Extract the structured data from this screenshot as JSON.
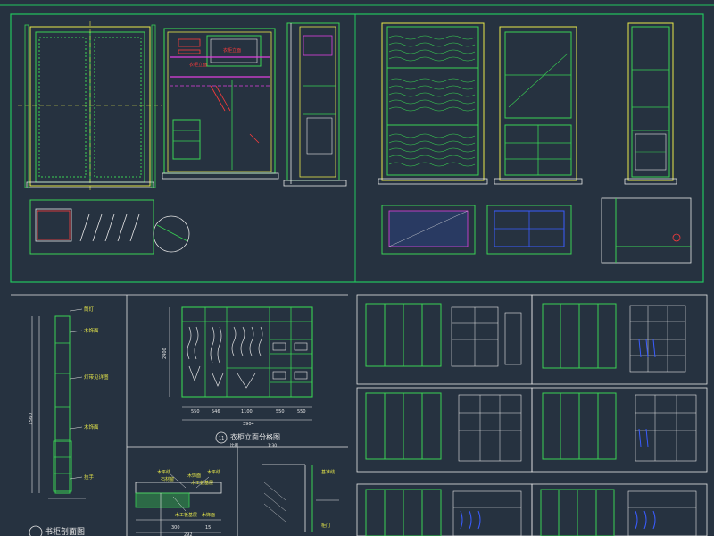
{
  "colors": {
    "background": "#263240",
    "frame": "#22c55e",
    "line": "#39d353",
    "yellow": "#e8e84a",
    "magenta": "#e040e0",
    "red": "#ff3b3b",
    "cyan": "#46d6ff",
    "blue": "#3a5cff",
    "white": "#e6e6e6"
  },
  "drawings": {
    "cabinet_elevation_title": "衣柜立面分格图",
    "cabinet_elevation_number": "11",
    "cabinet_elevation_scale_label": "比例",
    "cabinet_elevation_scale": "1:30",
    "bookcase_section_title": "书柜剖面图",
    "wardrobe_total_width": "3904",
    "wardrobe_segments": [
      "550",
      "546",
      "1100",
      "550",
      "550"
    ],
    "wardrobe_height": "2400",
    "section_total": "292",
    "section_dims": [
      "300",
      "15"
    ],
    "bookcase_height": "1560"
  },
  "callouts": {
    "top_lamp": "筒灯",
    "wood_trim": "木饰面",
    "led_strip": "灯带见详图",
    "wood_trim_2": "木饰面",
    "handle": "拉手",
    "sill_top": "木平线",
    "sill_left": "石材窗",
    "wood_panel": "木饰面",
    "plywood_base": "木工板基层",
    "sill_right": "木平线",
    "plywood_base_2": "木工板基层",
    "wood_panel_2": "木饰面",
    "far_right_note": "基准线",
    "red_tag_1": "衣柜立面",
    "red_tag_2": "衣柜立面",
    "detail_note": "柜门"
  }
}
